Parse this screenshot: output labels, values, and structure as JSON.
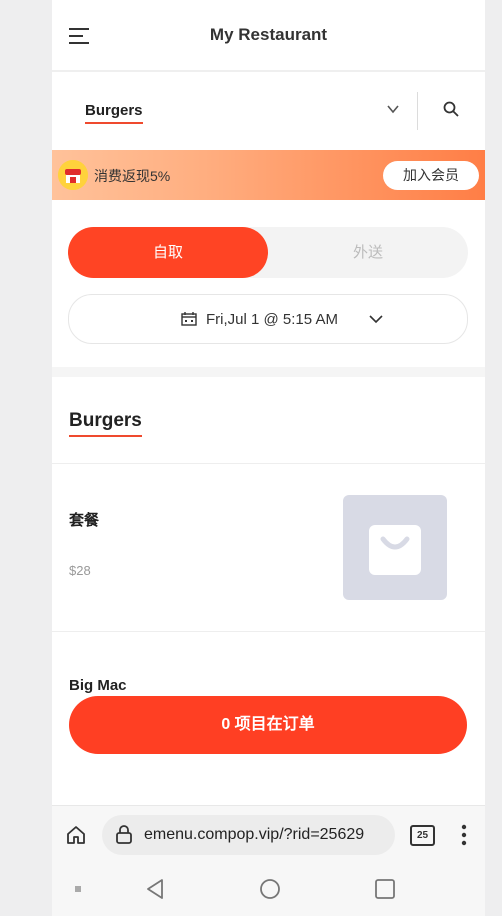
{
  "header": {
    "title": "My Restaurant",
    "menu_icon": "hamburger-menu-icon"
  },
  "category_bar": {
    "selected": "Burgers",
    "chevron_icon": "chevron-down-icon",
    "search_icon": "search-icon"
  },
  "promo": {
    "text": "消费返现5%",
    "button_label": "加入会员",
    "icon": "shop-icon"
  },
  "order_mode": {
    "active": "自取",
    "inactive": "外送"
  },
  "pickup_time": {
    "value": "Fri,Jul 1 @ 5:15 AM",
    "icon": "calendar-icon"
  },
  "menu_section": {
    "title": "Burgers",
    "items": [
      {
        "name": "套餐",
        "price": "$28",
        "image_icon": "shopping-bag-icon"
      },
      {
        "name": "Big Mac"
      }
    ]
  },
  "cart": {
    "label": "0 项目在订单"
  },
  "browser": {
    "url": "emenu.compop.vip/?rid=25629",
    "tab_count": "25"
  },
  "colors": {
    "accent": "#ff4424",
    "promo_gradient_start": "#ffc29a",
    "promo_gradient_end": "#ff7e46"
  }
}
